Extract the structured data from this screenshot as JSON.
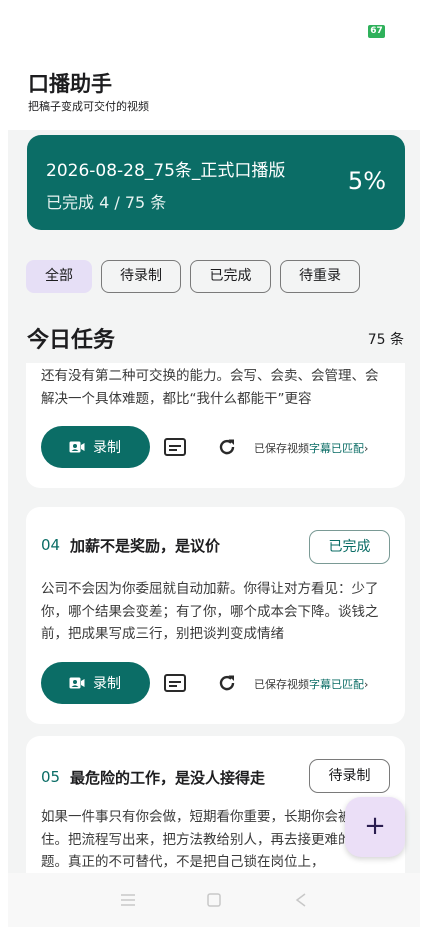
{
  "status_bar": {
    "battery": "67"
  },
  "app": {
    "title": "口播助手",
    "subtitle": "把稿子变成可交付的视频"
  },
  "banner": {
    "title": "2026-08-28_75条_正式口播版",
    "progress": "已完成 4 / 75 条",
    "percent": "5%",
    "color": "#0b6d66"
  },
  "filters": [
    {
      "label": "全部",
      "active": true
    },
    {
      "label": "待录制",
      "active": false
    },
    {
      "label": "已完成",
      "active": false
    },
    {
      "label": "待重录",
      "active": false
    }
  ],
  "section": {
    "title": "今日任务",
    "count": "75 条"
  },
  "cards": [
    {
      "body": "还有没有第二种可交换的能力。会写、会卖、会管理、会解决一个具体难题，都比“我什么都能干”更容",
      "record_label": "录制",
      "saved_prefix": "已保存视频",
      "saved_matched": "字幕已匹配",
      "saved_arrow": "›"
    },
    {
      "number": "04",
      "title": "加薪不是奖励，是议价",
      "status": "已完成",
      "body": "公司不会因为你委屈就自动加薪。你得让对方看见：少了你，哪个结果会变差；有了你，哪个成本会下降。谈钱之前，把成果写成三行，别把谈判变成情绪",
      "record_label": "录制",
      "saved_prefix": "已保存视频",
      "saved_matched": "字幕已匹配",
      "saved_arrow": "›"
    },
    {
      "number": "05",
      "title": "最危险的工作，是没人接得走",
      "status": "待录制",
      "body": "如果一件事只有你会做，短期看你重要，长期你会被困住。把流程写出来，把方法教给别人，再去接更难的问题。真正的不可替代，不是把自己锁在岗位上，"
    }
  ],
  "fab": {
    "label": "+"
  },
  "icons": {
    "camera": "video-camera-icon",
    "subtitles": "subtitles-icon",
    "refresh": "refresh-icon",
    "add": "plus-icon",
    "nav_menu": "menu-icon",
    "nav_home": "square-home-icon",
    "nav_back": "back-triangle-icon"
  }
}
